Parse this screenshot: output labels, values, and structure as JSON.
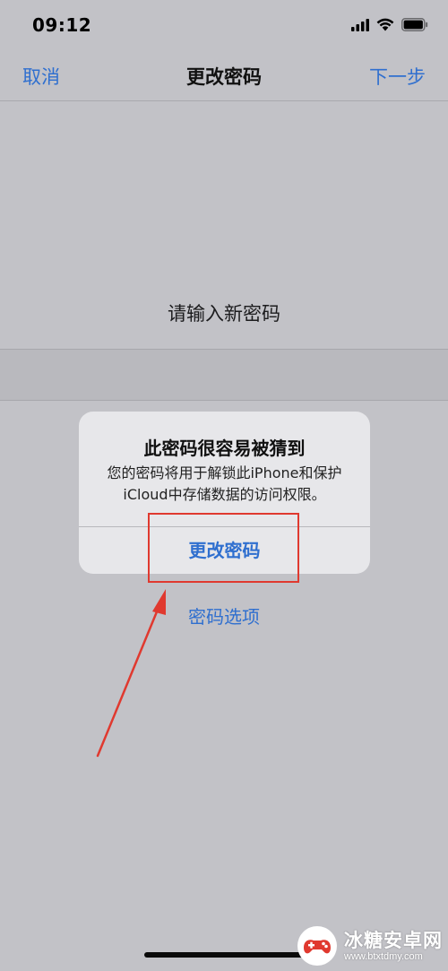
{
  "status_bar": {
    "time": "09:12",
    "icons": [
      "signal-icon",
      "wifi-icon",
      "battery-icon"
    ]
  },
  "nav": {
    "left_label": "取消",
    "title": "更改密码",
    "right_label": "下一步"
  },
  "main": {
    "prompt": "请输入新密码",
    "password_value": ""
  },
  "alert": {
    "title": "此密码很容易被猜到",
    "message": "您的密码将用于解锁此iPhone和保护iCloud中存储数据的访问权限。",
    "button_label": "更改密码"
  },
  "options_link": "密码选项",
  "watermark": {
    "title": "冰糖安卓网",
    "url": "www.btxtdmy.com"
  },
  "colors": {
    "accent": "#2f6fcf",
    "background": "#c2c2c7",
    "annotation": "#e0392f"
  }
}
